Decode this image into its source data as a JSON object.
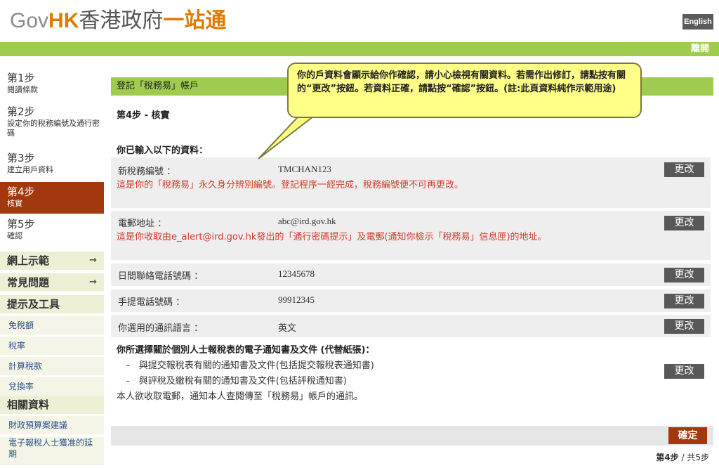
{
  "header": {
    "logo_gov": "Gov",
    "logo_hk": "HK",
    "logo_zh1": "香港政府",
    "logo_zh2": "一站通",
    "language_button": "English",
    "logout": "離開"
  },
  "sidebar": {
    "steps": [
      {
        "num": "第1步",
        "text": "閱讀條款"
      },
      {
        "num": "第2步",
        "text": "設定你的稅務編號及通行密碼"
      },
      {
        "num": "第3步",
        "text": "建立用戶資料"
      },
      {
        "num": "第4步",
        "text": "核實"
      },
      {
        "num": "第5步",
        "text": "確認"
      }
    ],
    "menus": [
      {
        "label": "網上示範",
        "arrow": "→"
      },
      {
        "label": "常見問題",
        "arrow": "→"
      },
      {
        "label": "提示及工具"
      }
    ],
    "tools": [
      "免稅額",
      "稅率",
      "計算稅款",
      "兌換率"
    ],
    "related_heading": "相關資料",
    "related": [
      "財政預算案建議",
      "電子報稅人士獲准的延期"
    ]
  },
  "main": {
    "title": "登記「稅務易」帳戶",
    "step_heading": "第4步 - 核實",
    "entered_heading": "你已輸入以下的資料：",
    "rows": [
      {
        "label": "新稅務編號 ：",
        "value": "TMCHAN123",
        "note": "這是你的「稅務易」永久身分辨別編號。登記程序一經完成，稅務編號便不可再更改。",
        "button": "更改"
      },
      {
        "label": "電郵地址 ：",
        "value": "abc@ird.gov.hk",
        "note": "這是你收取由e_alert@ird.gov.hk發出的「通行密碼提示」及電郵(通知你檢示「稅務易」信息匣)的地址。",
        "button": "更改"
      },
      {
        "label": "日間聯絡電話號碼 ：",
        "value": "12345678",
        "button": "更改"
      },
      {
        "label": "手提電話號碼 ：",
        "value": "99912345",
        "button": "更改"
      },
      {
        "label": "你選用的通訊語言 ：",
        "value": "英文",
        "button": "更改"
      }
    ],
    "notice": {
      "heading": "你所選擇關於個別人士報稅表的電子通知書及文件 (代替紙張)：",
      "items": [
        "-　與提交報稅表有關的通知書及文件(包括提交報稅表通知書)",
        "-　與評稅及繳稅有關的通知書及文件(包括評稅通知書)"
      ],
      "footer": "本人欲收取電郵，通知本人查閱傳至「稅務易」帳戶的通訊。",
      "button": "更改"
    },
    "confirm_button": "確定",
    "progress_current": "第4步",
    "progress_sep": "/",
    "progress_total": "共5步"
  },
  "callout": {
    "text": "你的戶資料會顯示給你作確認，請小心檢視有關資料。若需作出修訂，請點按有關的“更改”按鈕。若資料正確，請點按“確認”按鈕。(註:此頁資料純作示範用途)"
  },
  "colors": {
    "brand_orange": "#e07a00",
    "green_bar": "#9fcc4e",
    "active_step": "#a3380f",
    "note_red": "#d33a2c",
    "button_gray": "#585858",
    "callout_yellow": "#ffff88"
  }
}
